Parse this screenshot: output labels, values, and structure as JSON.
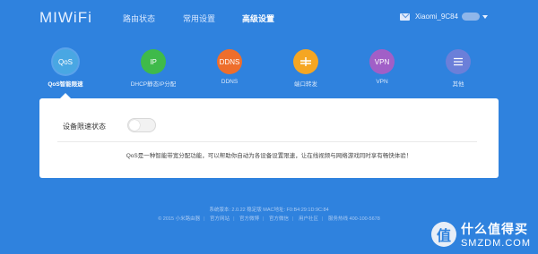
{
  "header": {
    "logo": "MIWiFi",
    "nav": [
      {
        "label": "路由状态",
        "active": false
      },
      {
        "label": "常用设置",
        "active": false
      },
      {
        "label": "高级设置",
        "active": true
      }
    ],
    "user": {
      "name": "Xiaomi_9C84",
      "icon": "mail-icon"
    }
  },
  "tiles": [
    {
      "icon_text": "QoS",
      "label": "QoS智能限速",
      "color": "#49a7e3",
      "active": true
    },
    {
      "icon_text": "IP",
      "label": "DHCP静态IP分配",
      "color": "#3fba4a",
      "active": false
    },
    {
      "icon_text": "DDNS",
      "label": "DDNS",
      "color": "#ee6e2c",
      "active": false
    },
    {
      "icon_text": "",
      "label": "端口转发",
      "color": "#f5a623",
      "active": false,
      "icon": "port-forward-icon"
    },
    {
      "icon_text": "VPN",
      "label": "VPN",
      "color": "#a15fc7",
      "active": false
    },
    {
      "icon_text": "",
      "label": "其他",
      "color": "#6b7fd9",
      "active": false,
      "icon": "menu-icon"
    }
  ],
  "panel": {
    "status_label": "设备限速状态",
    "toggle_on": false,
    "description": "QoS是一种智能带宽分配功能，可以帮助你自动为各设备设置限速，让在线视频与网络游戏同时享有畅快体验！"
  },
  "footer": {
    "line1": "系统版本: 2.0.22 稳定版   MAC地址: F0:B4:29:1D:9C:84",
    "links": [
      "© 2015 小米路由器",
      "官方网站",
      "官方微博",
      "官方微信",
      "用户社区",
      "服务热线 400-100-5678"
    ]
  },
  "watermark": {
    "badge": "值",
    "cn": "什么值得买",
    "en": "SMZDM.COM"
  }
}
